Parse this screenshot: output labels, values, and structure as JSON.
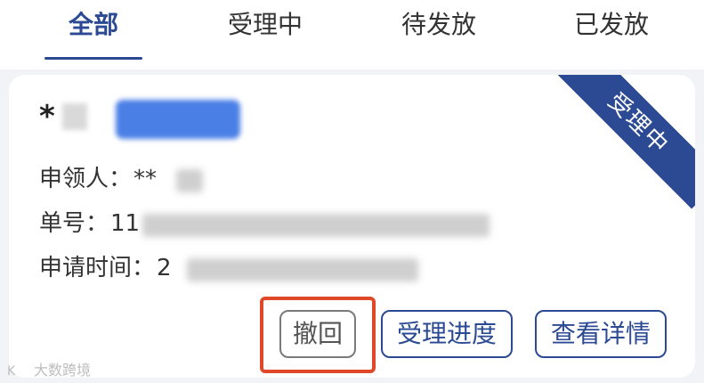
{
  "tabs": [
    {
      "label": "全部",
      "active": true
    },
    {
      "label": "受理中",
      "active": false
    },
    {
      "label": "待发放",
      "active": false
    },
    {
      "label": "已发放",
      "active": false
    }
  ],
  "card": {
    "status_ribbon": "受理中",
    "title_prefix": "*",
    "fields": {
      "applicant_label": "申领人：",
      "applicant_value": "**",
      "number_label": "单号：",
      "number_value": "11",
      "time_label": "申请时间：",
      "time_value": "2"
    },
    "buttons": {
      "revoke": "撤回",
      "progress": "受理进度",
      "details": "查看详情"
    }
  },
  "watermark": {
    "icon": "K",
    "text": "大数跨境"
  },
  "colors": {
    "brand": "#2b4a93",
    "highlight": "#e0482a",
    "background": "#f2f3f7"
  }
}
